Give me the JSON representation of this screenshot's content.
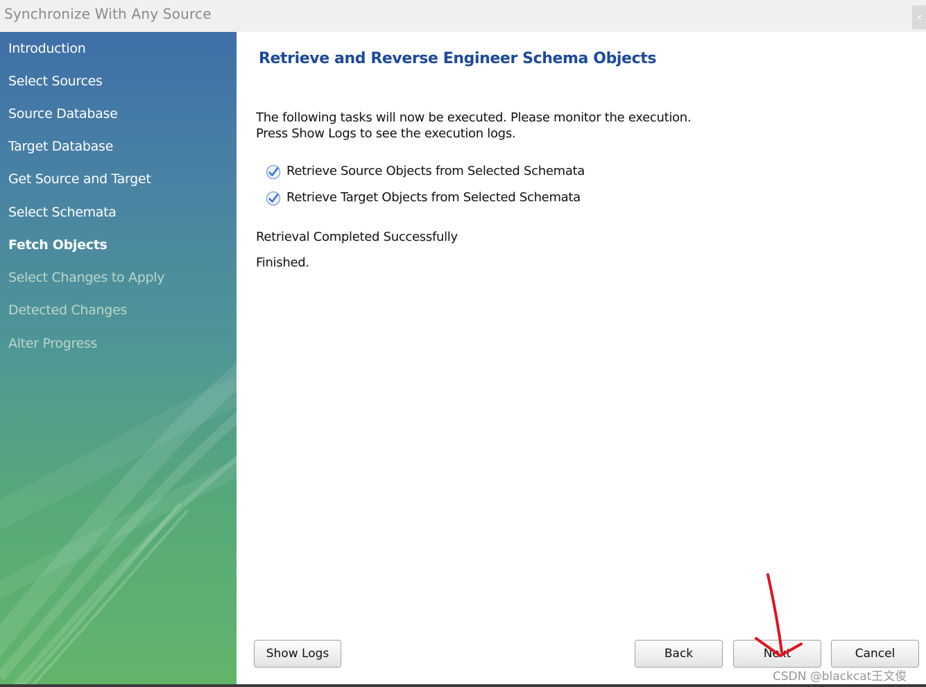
{
  "window": {
    "title": "Synchronize With Any Source",
    "close_glyph": "×"
  },
  "sidebar": {
    "items": [
      {
        "label": "Introduction",
        "state": "done"
      },
      {
        "label": "Select Sources",
        "state": "done"
      },
      {
        "label": "Source Database",
        "state": "done"
      },
      {
        "label": "Target Database",
        "state": "done"
      },
      {
        "label": "Get Source and Target",
        "state": "done"
      },
      {
        "label": "Select Schemata",
        "state": "done"
      },
      {
        "label": "Fetch Objects",
        "state": "current"
      },
      {
        "label": "Select Changes to Apply",
        "state": "future"
      },
      {
        "label": "Detected Changes",
        "state": "future"
      },
      {
        "label": "Alter Progress",
        "state": "future"
      }
    ]
  },
  "main": {
    "heading": "Retrieve and Reverse Engineer Schema Objects",
    "intro_line1": "The following tasks will now be executed. Please monitor the execution.",
    "intro_line2": "Press Show Logs to see the execution logs.",
    "tasks": [
      {
        "label": "Retrieve Source Objects from Selected Schemata",
        "status": "completed"
      },
      {
        "label": "Retrieve Target Objects from Selected Schemata",
        "status": "completed"
      }
    ],
    "status_text": "Retrieval Completed Successfully",
    "finished_text": "Finished."
  },
  "buttons": {
    "show_logs": "Show Logs",
    "back": "Back",
    "next": "Next",
    "cancel": "Cancel"
  },
  "icons": {
    "task_status": "check-circle-icon",
    "annotation": "red-arrow-down-icon"
  },
  "colors": {
    "heading": "#1c4a9c",
    "annotation": "#e0141e",
    "check": "#3a6fd8"
  },
  "watermark": "CSDN @blackcat王文俊"
}
